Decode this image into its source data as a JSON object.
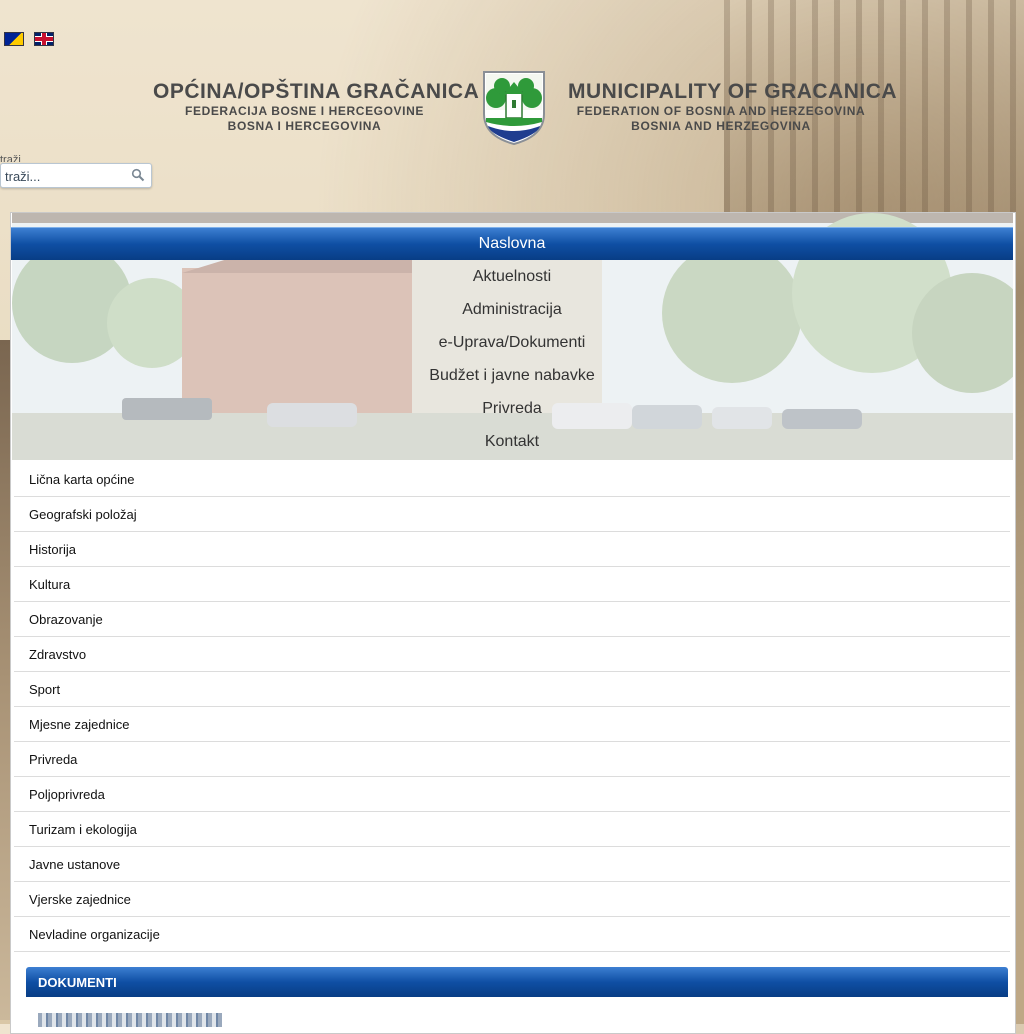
{
  "flags": [
    {
      "name": "bosnian-flag-icon",
      "lang": "bs"
    },
    {
      "name": "english-flag-icon",
      "lang": "en"
    }
  ],
  "header": {
    "left": {
      "title": "OPĆINA/OPŠTINA GRAČANICA",
      "line1": "FEDERACIJA BOSNE I HERCEGOVINE",
      "line2": "BOSNA I HERCEGOVINA"
    },
    "right": {
      "title": "MUNICIPALITY OF GRACANICA",
      "line1": "FEDERATION OF BOSNIA AND HERZEGOVINA",
      "line2": "BOSNIA AND HERZEGOVINA"
    }
  },
  "search": {
    "label": "traži",
    "placeholder": "traži..."
  },
  "topnav": {
    "active": "Naslovna",
    "items": [
      "Aktuelnosti",
      "Administracija",
      "e-Uprava/Dokumenti",
      "Budžet i javne nabavke",
      "Privreda",
      "Kontakt"
    ]
  },
  "sidemenu": {
    "items": [
      "Lična karta općine",
      "Geografski položaj",
      "Historija",
      "Kultura",
      "Obrazovanje",
      "Zdravstvo",
      "Sport",
      "Mjesne zajednice",
      "Privreda",
      "Poljoprivreda",
      "Turizam i ekologija",
      "Javne ustanove",
      "Vjerske zajednice",
      "Nevladine organizacije"
    ]
  },
  "dokumenti": {
    "title": "DOKUMENTI"
  },
  "colors": {
    "accent_blue": "#0f4fa4",
    "header_text": "#4a4a4a"
  }
}
